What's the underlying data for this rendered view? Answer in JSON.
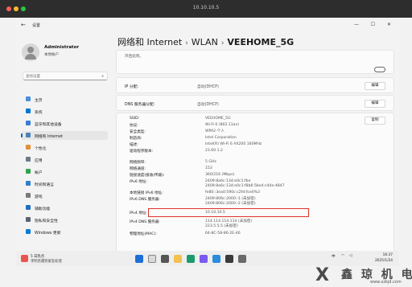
{
  "vm": {
    "title": "10.10.10.5"
  },
  "window": {
    "app_title": "设置",
    "back": "←",
    "min": "—",
    "max": "☐",
    "close": "✕"
  },
  "user": {
    "name": "Administrator",
    "role": "本地帐户"
  },
  "search": {
    "placeholder": "查找设置",
    "icon": "search-icon"
  },
  "nav": [
    {
      "label": "主页",
      "color": "#4a90d9"
    },
    {
      "label": "系统",
      "color": "#0078d4"
    },
    {
      "label": "蓝牙和其他设备",
      "color": "#3a7bd5"
    },
    {
      "label": "网络和 Internet",
      "color": "#4e7fb8",
      "active": true
    },
    {
      "label": "个性化",
      "color": "#e0913a"
    },
    {
      "label": "应用",
      "color": "#6c7a8a"
    },
    {
      "label": "帐户",
      "color": "#2ea44f"
    },
    {
      "label": "时间和语言",
      "color": "#2f80c8"
    },
    {
      "label": "游戏",
      "color": "#7a7a7a"
    },
    {
      "label": "辅助功能",
      "color": "#1f6fbf"
    },
    {
      "label": "隐私和安全性",
      "color": "#5a6470"
    },
    {
      "label": "Windows 更新",
      "color": "#0a7bd6"
    }
  ],
  "breadcrumb": {
    "part1": "网络和 Internet",
    "sep": "›",
    "part2": "WLAN",
    "part3": "VEEHOME_5G"
  },
  "top_text": "开启此项。",
  "ip_assign": {
    "label": "IP 分配:",
    "value": "自动(DHCP)",
    "button": "编辑"
  },
  "dns_assign": {
    "label": "DNS 服务器分配:",
    "value": "自动(DHCP)",
    "button": "编辑"
  },
  "copy_button": "复制",
  "properties": [
    {
      "label": "SSID:",
      "value": "VEEHOME_5G"
    },
    {
      "label": "协议:",
      "value": "Wi-Fi 6 (802.11ax)"
    },
    {
      "label": "安全类型:",
      "value": "WPA2-个人"
    },
    {
      "label": "制造商:",
      "value": "Intel Corporation"
    },
    {
      "label": "描述:",
      "value": "Intel(R) Wi-Fi 6 AX200 160MHz"
    },
    {
      "label": "驱动程序版本:",
      "value": "23.60.1.2"
    },
    {
      "label": "网络频带:",
      "value": "5 GHz"
    },
    {
      "label": "网络通道:",
      "value": "153"
    },
    {
      "label": "链接速度(接收/传输):",
      "value": "360/216 (Mbps)"
    },
    {
      "label": "IPv6 地址:",
      "value": "2409:8a6c:134:e0c1:fbe\n2409:8a6c:134:e0c1:f8b6:5be4:c44e:4847"
    },
    {
      "label": "本地链接 IPv6 地址:",
      "value": "fe80::3ea0:590c:c2fd:fce0%3"
    },
    {
      "label": "IPv6 DNS 服务器:",
      "value": "2409:806c:2000::1 (未加密)\n2409:806c:2000::2 (未加密)"
    },
    {
      "label": "IPv4 地址:",
      "value": "10.10.10.5"
    },
    {
      "label": "IPv4 DNS 服务器:",
      "value": "114.114.114.114 (未加密)\n223.5.5.5 (未加密)"
    },
    {
      "label": "物理地址(MAC):",
      "value": "64-8C-58-86-2E-46"
    }
  ],
  "taskbar": {
    "weather_line1": "5 日热点",
    "weather_line2": "李明亮遭到紧急处理",
    "tray_lang": "中",
    "time": "16:37",
    "date": "2025/1/24"
  },
  "watermark": {
    "big": "鑫 琼 机 电",
    "small": "www.xzkjd.com"
  }
}
